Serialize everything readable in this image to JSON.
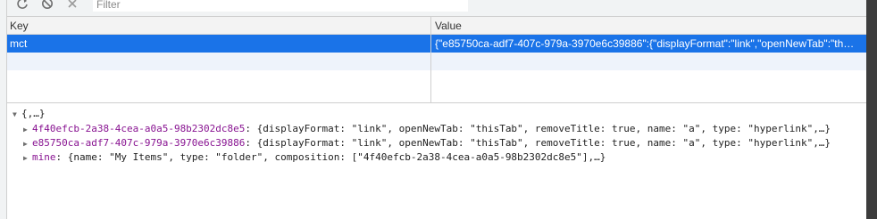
{
  "toolbar": {
    "filter_placeholder": "Filter"
  },
  "grid": {
    "columns": {
      "key": "Key",
      "value": "Value"
    },
    "rows": [
      {
        "key": "mct",
        "value": "{\"e85750ca-adf7-407c-979a-3970e6c39886\":{\"displayFormat\":\"link\",\"openNewTab\":\"thi…"
      }
    ]
  },
  "tree": {
    "root": "{,…}",
    "items": [
      {
        "key": "4f40efcb-2a38-4cea-a0a5-98b2302dc8e5",
        "value": ": {displayFormat: \"link\", openNewTab: \"thisTab\", removeTitle: true, name: \"a\", type: \"hyperlink\",…}"
      },
      {
        "key": "e85750ca-adf7-407c-979a-3970e6c39886",
        "value": ": {displayFormat: \"link\", openNewTab: \"thisTab\", removeTitle: true, name: \"a\", type: \"hyperlink\",…}"
      },
      {
        "key": "mine",
        "value": ": {name: \"My Items\", type: \"folder\", composition: [\"4f40efcb-2a38-4cea-a0a5-98b2302dc8e5\"],…}"
      }
    ]
  },
  "colors": {
    "selection": "#1a73e8",
    "key_purple": "#881391"
  },
  "icons": {
    "refresh": "refresh-icon",
    "clear": "block-icon",
    "delete": "close-icon"
  }
}
